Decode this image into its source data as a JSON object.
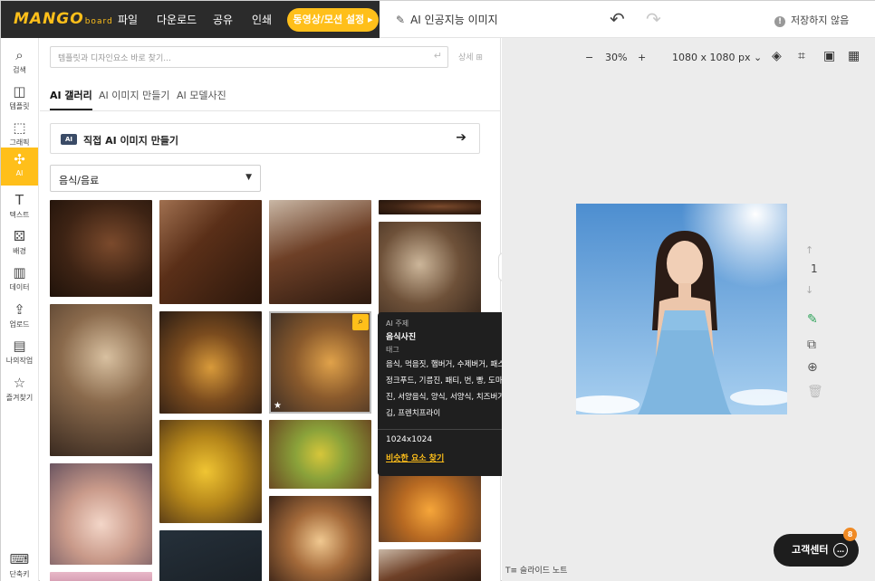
{
  "brand": {
    "logo": "MANGO",
    "logo_sub": "board",
    "accent": "#ffbf1a"
  },
  "topbar": {
    "menu": [
      "파일",
      "다운로드",
      "공유",
      "인쇄"
    ],
    "cta": "동영상/모션 설정 ▸",
    "ai_tab": "AI 인공지능 이미지",
    "save_status": "저장하지 않음"
  },
  "sidebar": {
    "items": [
      {
        "label": "검색",
        "icon": "search-icon"
      },
      {
        "label": "템플릿",
        "icon": "template-icon"
      },
      {
        "label": "그래픽",
        "icon": "graphic-icon"
      },
      {
        "label": "AI",
        "icon": "ai-icon"
      },
      {
        "label": "텍스트",
        "icon": "text-icon"
      },
      {
        "label": "배경",
        "icon": "background-icon"
      },
      {
        "label": "데이터",
        "icon": "data-icon"
      },
      {
        "label": "업로드",
        "icon": "upload-icon"
      },
      {
        "label": "나의작업",
        "icon": "my-work-icon"
      },
      {
        "label": "즐겨찾기",
        "icon": "star-icon"
      },
      {
        "label": "단축키",
        "icon": "keyboard-icon"
      }
    ]
  },
  "panel": {
    "search_placeholder": "템플릿과 디자인요소 바로 찾기...",
    "detail_link": "상세",
    "tabs": [
      "AI 갤러리",
      "AI 이미지 만들기",
      "AI 모델사진"
    ],
    "make_badge": "AI",
    "make_label": "직접 AI 이미지 만들기",
    "category": "음식/음료"
  },
  "tooltip": {
    "theme_key": "AI 주제",
    "theme_val": "음식사진",
    "tags_key": "태그",
    "tags": "음식, 먹음짓, 햄버거, 수제버거, 패스트푸드, 정크푸드, 기름진, 패티, 번, 빵, 도마, 음식사진, 서양음식, 양식, 서양식, 치즈버거, 감자튀김, 프렌치프라이",
    "resolution": "1024x1024",
    "similar": "비슷한 요소 찾기"
  },
  "canvas": {
    "zoom": "30%",
    "size": "1080 x 1080 px",
    "page": "1",
    "slide_note": "슬라이드 노트"
  },
  "support": {
    "label": "고객센터",
    "count": "8"
  }
}
